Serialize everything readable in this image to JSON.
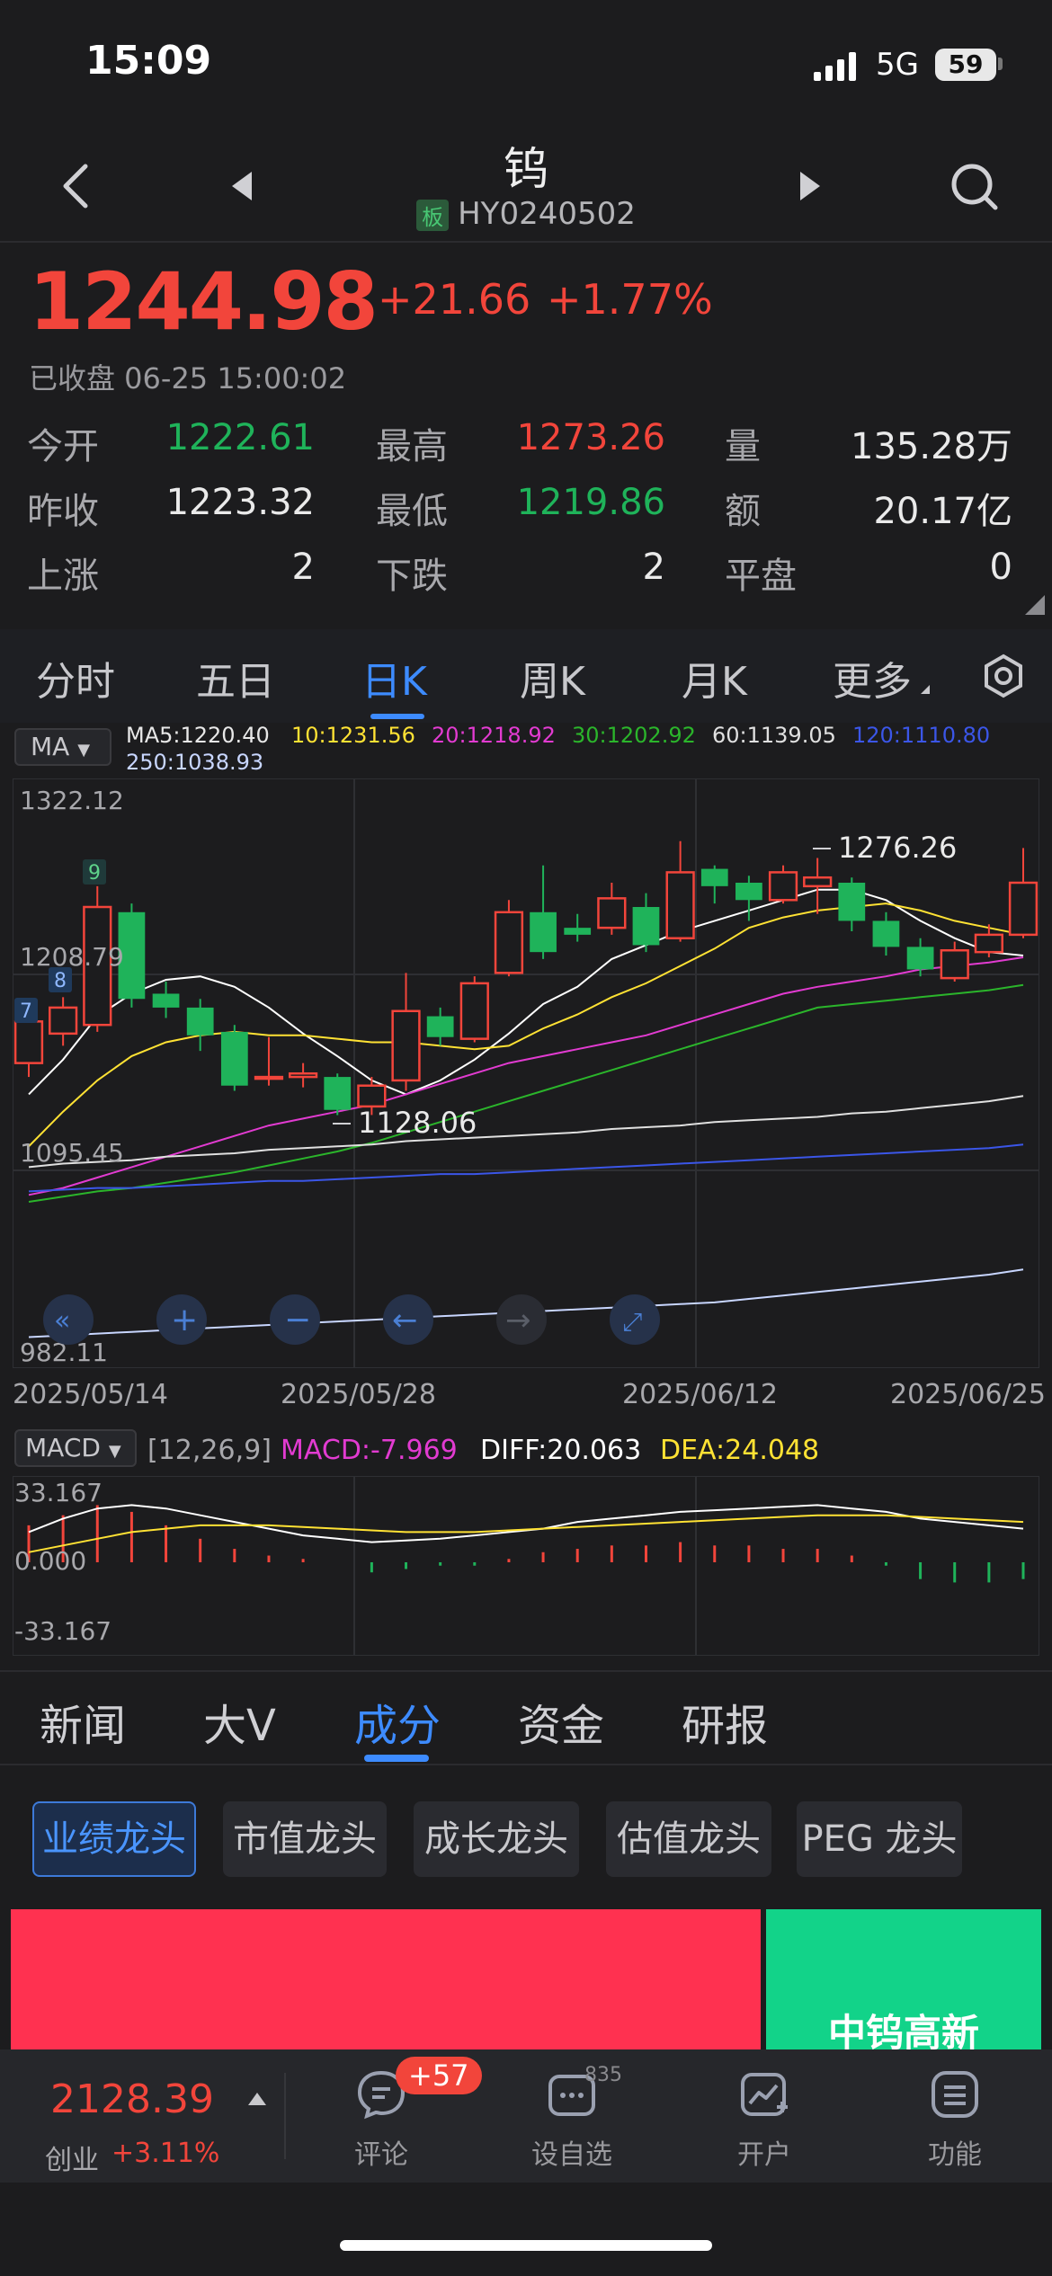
{
  "status_bar": {
    "time": "15:09",
    "network": "5G",
    "battery": "59"
  },
  "nav": {
    "title": "钨",
    "board_tag": "板",
    "code": "HY0240502"
  },
  "quote": {
    "price": "1244.98",
    "change": "+21.66",
    "change_pct": "+1.77%",
    "status": "已收盘 06-25 15:00:02",
    "stats": [
      [
        {
          "label": "今开",
          "value": "1222.61",
          "color": "green"
        },
        {
          "label": "最高",
          "value": "1273.26",
          "color": "red"
        },
        {
          "label": "量",
          "value": "135.28万",
          "color": "white"
        }
      ],
      [
        {
          "label": "昨收",
          "value": "1223.32",
          "color": "white"
        },
        {
          "label": "最低",
          "value": "1219.86",
          "color": "green"
        },
        {
          "label": "额",
          "value": "20.17亿",
          "color": "white"
        }
      ],
      [
        {
          "label": "上涨",
          "value": "2",
          "color": "white"
        },
        {
          "label": "下跌",
          "value": "2",
          "color": "white"
        },
        {
          "label": "平盘",
          "value": "0",
          "color": "white"
        }
      ]
    ]
  },
  "period_tabs": [
    "分时",
    "五日",
    "日K",
    "周K",
    "月K",
    "更多"
  ],
  "active_period": "日K",
  "indicators": {
    "ma_select": "MA",
    "ma_values": [
      {
        "text": "MA5:1220.40",
        "color": "#ffffff"
      },
      {
        "text": "10:1231.56",
        "color": "#ffe234"
      },
      {
        "text": "20:1218.92",
        "color": "#e23bd1"
      },
      {
        "text": "30:1202.92",
        "color": "#2bb52b"
      },
      {
        "text": "60:1139.05",
        "color": "#e0e0e0"
      },
      {
        "text": "120:1110.80",
        "color": "#3b56e8"
      },
      {
        "text": "250:1038.93",
        "color": "#c8d6ff"
      }
    ],
    "macd_select": "MACD",
    "macd_params": "[12,26,9]",
    "macd": "MACD:-7.969",
    "diff": "DIFF:20.063",
    "dea": "DEA:24.048",
    "macd_colors": {
      "macd": "#e23bd1",
      "diff": "#ffffff",
      "dea": "#ffe234"
    }
  },
  "chart_data": {
    "type": "candlestick",
    "y_axis_labels": [
      "1322.12",
      "1208.79",
      "1095.45",
      "982.11"
    ],
    "ylim": [
      982.11,
      1322.12
    ],
    "x_axis_labels": [
      "2025/05/14",
      "2025/05/28",
      "2025/06/12",
      "2025/06/25"
    ],
    "annotations": {
      "high": "1276.26",
      "low": "1128.06",
      "markers": [
        "7",
        "8",
        "9"
      ]
    },
    "candles": [
      {
        "o": 1158,
        "c": 1182,
        "h": 1190,
        "l": 1150
      },
      {
        "o": 1175,
        "c": 1190,
        "h": 1196,
        "l": 1168
      },
      {
        "o": 1180,
        "c": 1248,
        "h": 1260,
        "l": 1176
      },
      {
        "o": 1245,
        "c": 1195,
        "h": 1250,
        "l": 1190
      },
      {
        "o": 1198,
        "c": 1190,
        "h": 1205,
        "l": 1184
      },
      {
        "o": 1190,
        "c": 1174,
        "h": 1195,
        "l": 1165
      },
      {
        "o": 1176,
        "c": 1145,
        "h": 1180,
        "l": 1142
      },
      {
        "o": 1150,
        "c": 1150,
        "h": 1173,
        "l": 1145
      },
      {
        "o": 1150,
        "c": 1152,
        "h": 1158,
        "l": 1144
      },
      {
        "o": 1150,
        "c": 1131,
        "h": 1152,
        "l": 1128
      },
      {
        "o": 1133,
        "c": 1145,
        "h": 1150,
        "l": 1128.06
      },
      {
        "o": 1148,
        "c": 1188,
        "h": 1210,
        "l": 1142
      },
      {
        "o": 1185,
        "c": 1173,
        "h": 1190,
        "l": 1168
      },
      {
        "o": 1172,
        "c": 1204,
        "h": 1208,
        "l": 1170
      },
      {
        "o": 1210,
        "c": 1245,
        "h": 1252,
        "l": 1208
      },
      {
        "o": 1245,
        "c": 1222,
        "h": 1272,
        "l": 1218
      },
      {
        "o": 1236,
        "c": 1232,
        "h": 1244,
        "l": 1228
      },
      {
        "o": 1236,
        "c": 1253,
        "h": 1262,
        "l": 1232
      },
      {
        "o": 1248,
        "c": 1226,
        "h": 1256,
        "l": 1222
      },
      {
        "o": 1230,
        "c": 1268,
        "h": 1286,
        "l": 1228
      },
      {
        "o": 1270,
        "c": 1260,
        "h": 1272,
        "l": 1250
      },
      {
        "o": 1262,
        "c": 1252,
        "h": 1266,
        "l": 1240
      },
      {
        "o": 1252,
        "c": 1268,
        "h": 1272,
        "l": 1250
      },
      {
        "o": 1260,
        "c": 1265,
        "h": 1276.26,
        "l": 1244
      },
      {
        "o": 1262,
        "c": 1240,
        "h": 1265,
        "l": 1234
      },
      {
        "o": 1240,
        "c": 1225,
        "h": 1245,
        "l": 1220
      },
      {
        "o": 1225,
        "c": 1212,
        "h": 1230,
        "l": 1208
      },
      {
        "o": 1207,
        "c": 1223,
        "h": 1228,
        "l": 1205
      },
      {
        "o": 1222,
        "c": 1232,
        "h": 1238,
        "l": 1219
      },
      {
        "o": 1232,
        "c": 1262,
        "h": 1282,
        "l": 1230
      }
    ],
    "ma_lines": {
      "MA5": [
        1140,
        1160,
        1185,
        1198,
        1206,
        1208,
        1202,
        1190,
        1175,
        1162,
        1148,
        1140,
        1148,
        1160,
        1175,
        1192,
        1202,
        1218,
        1226,
        1234,
        1240,
        1246,
        1252,
        1258,
        1258,
        1252,
        1240,
        1230,
        1222,
        1220
      ],
      "MA10": [
        1110,
        1130,
        1148,
        1162,
        1170,
        1174,
        1176,
        1174,
        1174,
        1172,
        1170,
        1170,
        1168,
        1166,
        1168,
        1178,
        1186,
        1196,
        1204,
        1214,
        1224,
        1236,
        1242,
        1246,
        1248,
        1250,
        1246,
        1240,
        1236,
        1232
      ],
      "MA20": [
        1082,
        1086,
        1092,
        1098,
        1104,
        1110,
        1116,
        1122,
        1126,
        1130,
        1134,
        1140,
        1146,
        1152,
        1158,
        1162,
        1166,
        1170,
        1174,
        1180,
        1186,
        1192,
        1198,
        1202,
        1205,
        1208,
        1212,
        1214,
        1216,
        1219
      ],
      "MA30": [
        1078,
        1081,
        1084,
        1086,
        1089,
        1092,
        1095,
        1099,
        1103,
        1107,
        1112,
        1118,
        1124,
        1130,
        1136,
        1142,
        1148,
        1154,
        1160,
        1166,
        1172,
        1178,
        1184,
        1190,
        1192,
        1194,
        1196,
        1198,
        1200,
        1203
      ],
      "MA60": [
        1098,
        1100,
        1101,
        1102,
        1104,
        1105,
        1106,
        1108,
        1109,
        1110,
        1111,
        1113,
        1114,
        1115,
        1116,
        1117,
        1118,
        1120,
        1121,
        1122,
        1124,
        1125,
        1126,
        1127,
        1129,
        1130,
        1132,
        1134,
        1136,
        1139
      ],
      "MA120": [
        1084,
        1085,
        1086,
        1086,
        1087,
        1088,
        1089,
        1090,
        1090,
        1091,
        1092,
        1093,
        1094,
        1094,
        1095,
        1096,
        1097,
        1098,
        1099,
        1100,
        1101,
        1102,
        1103,
        1104,
        1105,
        1106,
        1107,
        1108,
        1109,
        1111
      ],
      "MA250": [
        1000,
        1001,
        1002,
        1003,
        1004,
        1005,
        1006,
        1007,
        1008,
        1009,
        1010,
        1011,
        1012,
        1013,
        1014,
        1015,
        1016,
        1017,
        1018,
        1019,
        1020,
        1022,
        1024,
        1026,
        1028,
        1030,
        1032,
        1034,
        1036,
        1039
      ]
    },
    "macd_axis": [
      "33.167",
      "0.000",
      "-33.167"
    ],
    "macd_hist": [
      22,
      28,
      34,
      30,
      22,
      14,
      8,
      4,
      2,
      0,
      -6,
      -4,
      -2,
      -2,
      2,
      6,
      8,
      10,
      10,
      12,
      10,
      10,
      8,
      8,
      4,
      -2,
      -10,
      -12,
      -12,
      -10
    ],
    "diff_line": [
      18,
      26,
      32,
      34,
      32,
      28,
      24,
      20,
      16,
      14,
      12,
      13,
      14,
      16,
      18,
      20,
      24,
      26,
      28,
      30,
      31,
      32,
      33,
      34,
      32,
      30,
      26,
      24,
      22,
      20
    ],
    "dea_line": [
      6,
      10,
      14,
      18,
      20,
      22,
      22,
      22,
      21,
      20,
      19,
      18,
      18,
      18,
      19,
      20,
      21,
      22,
      23,
      24,
      25,
      26,
      27,
      28,
      28,
      28,
      27,
      26,
      25,
      24
    ]
  },
  "chart_controls": [
    "double-left",
    "zoom-in",
    "zoom-out",
    "left",
    "right",
    "fullscreen"
  ],
  "news_tabs": [
    "新闻",
    "大V",
    "成分",
    "资金",
    "研报"
  ],
  "active_news_tab": "成分",
  "chips": [
    "业绩龙头",
    "市值龙头",
    "成长龙头",
    "估值龙头",
    "PEG 龙头"
  ],
  "heatmap": {
    "green_label": "中钨高新"
  },
  "bottom_bar": {
    "index_value": "2128.39",
    "index_name": "创业",
    "index_pct": "+3.11%",
    "comment_badge": "+57",
    "watch_count": "835",
    "items": [
      "评论",
      "设自选",
      "开户",
      "功能"
    ]
  },
  "colors": {
    "up": "#f2453b",
    "down": "#1fb35a",
    "accent": "#3d8bff"
  }
}
